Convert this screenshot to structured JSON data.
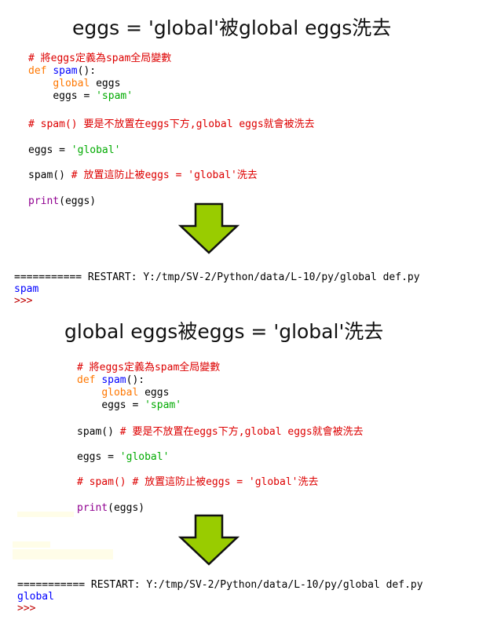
{
  "section1": {
    "title": "eggs = 'global'被global eggs洗去",
    "code": {
      "comment1": "# 將eggs定義為spam全局變數",
      "def_kw": "def",
      "func_name": "spam",
      "def_tail": "():",
      "global_kw": "global",
      "global_var": " eggs",
      "assign_lhs": "eggs = ",
      "assign_str": "'spam'",
      "comment2": "# spam() 要是不放置在eggs下方,global eggs就會被洗去",
      "eggs_lhs": "eggs = ",
      "eggs_str": "'global'",
      "call": "spam() ",
      "call_comment": "# 放置這防止被eggs = 'global'洗去",
      "print_kw": "print",
      "print_args": "(eggs)"
    },
    "shell": {
      "restart": "=========== RESTART: Y:/tmp/SV-2/Python/data/L-10/py/global def.py",
      "output": "spam",
      "prompt": ">>>"
    }
  },
  "section2": {
    "title": "global eggs被eggs = 'global'洗去",
    "code": {
      "comment1": "# 將eggs定義為spam全局變數",
      "def_kw": "def",
      "func_name": "spam",
      "def_tail": "():",
      "global_kw": "global",
      "global_var": " eggs",
      "assign_lhs": "eggs = ",
      "assign_str": "'spam'",
      "call": "spam() ",
      "call_comment": "# 要是不放置在eggs下方,global eggs就會被洗去",
      "eggs_lhs": "eggs = ",
      "eggs_str": "'global'",
      "comment3": "# spam() # 放置這防止被eggs = 'global'洗去",
      "print_kw": "print",
      "print_args": "(eggs)"
    },
    "shell": {
      "restart": "=========== RESTART: Y:/tmp/SV-2/Python/data/L-10/py/global def.py",
      "output": "global",
      "prompt": ">>>"
    }
  },
  "colors": {
    "arrow_fill": "#99cc00",
    "arrow_stroke": "#111111",
    "comment": "#dd0000",
    "keyword": "#ff7700",
    "string": "#00aa00",
    "function": "#0000ff",
    "builtin": "#900090"
  },
  "icons": {
    "arrow": "down-arrow-icon"
  }
}
